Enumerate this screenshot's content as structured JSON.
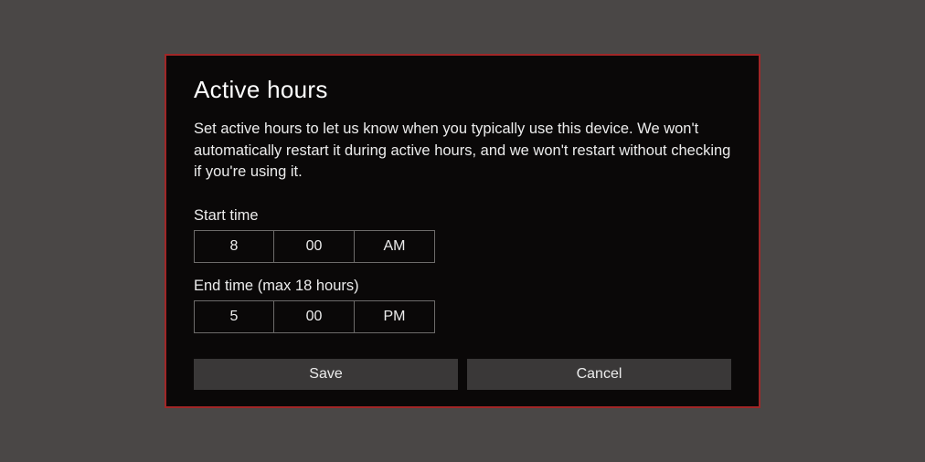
{
  "dialog": {
    "title": "Active hours",
    "description": "Set active hours to let us know when you typically use this device. We won't automatically restart it during active hours, and we won't restart without checking if you're using it.",
    "start_label": "Start time",
    "end_label": "End time (max 18 hours)",
    "start": {
      "hour": "8",
      "minute": "00",
      "period": "AM"
    },
    "end": {
      "hour": "5",
      "minute": "00",
      "period": "PM"
    },
    "buttons": {
      "save": "Save",
      "cancel": "Cancel"
    }
  }
}
